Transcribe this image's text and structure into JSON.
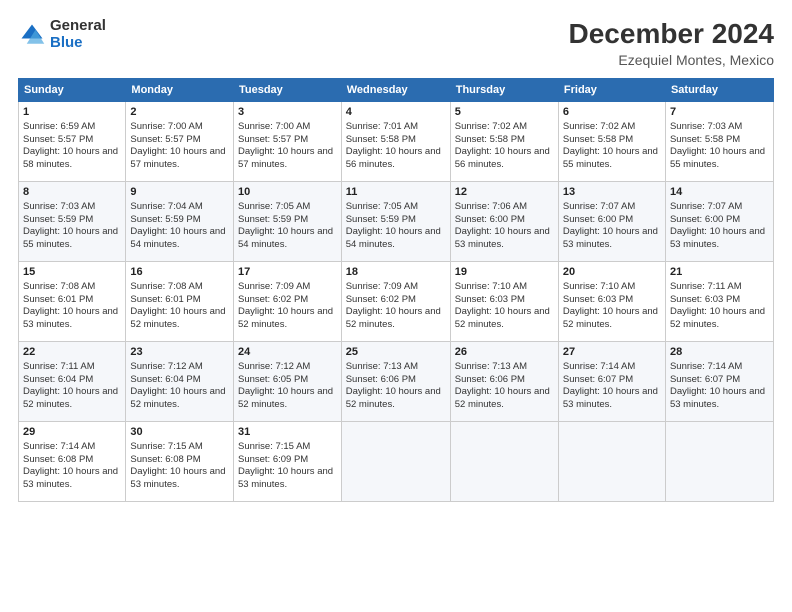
{
  "header": {
    "logo_general": "General",
    "logo_blue": "Blue",
    "month_title": "December 2024",
    "subtitle": "Ezequiel Montes, Mexico"
  },
  "days_of_week": [
    "Sunday",
    "Monday",
    "Tuesday",
    "Wednesday",
    "Thursday",
    "Friday",
    "Saturday"
  ],
  "weeks": [
    [
      {
        "day": "1",
        "sunrise": "6:59 AM",
        "sunset": "5:57 PM",
        "daylight": "10 hours and 58 minutes."
      },
      {
        "day": "2",
        "sunrise": "7:00 AM",
        "sunset": "5:57 PM",
        "daylight": "10 hours and 57 minutes."
      },
      {
        "day": "3",
        "sunrise": "7:00 AM",
        "sunset": "5:57 PM",
        "daylight": "10 hours and 57 minutes."
      },
      {
        "day": "4",
        "sunrise": "7:01 AM",
        "sunset": "5:58 PM",
        "daylight": "10 hours and 56 minutes."
      },
      {
        "day": "5",
        "sunrise": "7:02 AM",
        "sunset": "5:58 PM",
        "daylight": "10 hours and 56 minutes."
      },
      {
        "day": "6",
        "sunrise": "7:02 AM",
        "sunset": "5:58 PM",
        "daylight": "10 hours and 55 minutes."
      },
      {
        "day": "7",
        "sunrise": "7:03 AM",
        "sunset": "5:58 PM",
        "daylight": "10 hours and 55 minutes."
      }
    ],
    [
      {
        "day": "8",
        "sunrise": "7:03 AM",
        "sunset": "5:59 PM",
        "daylight": "10 hours and 55 minutes."
      },
      {
        "day": "9",
        "sunrise": "7:04 AM",
        "sunset": "5:59 PM",
        "daylight": "10 hours and 54 minutes."
      },
      {
        "day": "10",
        "sunrise": "7:05 AM",
        "sunset": "5:59 PM",
        "daylight": "10 hours and 54 minutes."
      },
      {
        "day": "11",
        "sunrise": "7:05 AM",
        "sunset": "5:59 PM",
        "daylight": "10 hours and 54 minutes."
      },
      {
        "day": "12",
        "sunrise": "7:06 AM",
        "sunset": "6:00 PM",
        "daylight": "10 hours and 53 minutes."
      },
      {
        "day": "13",
        "sunrise": "7:07 AM",
        "sunset": "6:00 PM",
        "daylight": "10 hours and 53 minutes."
      },
      {
        "day": "14",
        "sunrise": "7:07 AM",
        "sunset": "6:00 PM",
        "daylight": "10 hours and 53 minutes."
      }
    ],
    [
      {
        "day": "15",
        "sunrise": "7:08 AM",
        "sunset": "6:01 PM",
        "daylight": "10 hours and 53 minutes."
      },
      {
        "day": "16",
        "sunrise": "7:08 AM",
        "sunset": "6:01 PM",
        "daylight": "10 hours and 52 minutes."
      },
      {
        "day": "17",
        "sunrise": "7:09 AM",
        "sunset": "6:02 PM",
        "daylight": "10 hours and 52 minutes."
      },
      {
        "day": "18",
        "sunrise": "7:09 AM",
        "sunset": "6:02 PM",
        "daylight": "10 hours and 52 minutes."
      },
      {
        "day": "19",
        "sunrise": "7:10 AM",
        "sunset": "6:03 PM",
        "daylight": "10 hours and 52 minutes."
      },
      {
        "day": "20",
        "sunrise": "7:10 AM",
        "sunset": "6:03 PM",
        "daylight": "10 hours and 52 minutes."
      },
      {
        "day": "21",
        "sunrise": "7:11 AM",
        "sunset": "6:03 PM",
        "daylight": "10 hours and 52 minutes."
      }
    ],
    [
      {
        "day": "22",
        "sunrise": "7:11 AM",
        "sunset": "6:04 PM",
        "daylight": "10 hours and 52 minutes."
      },
      {
        "day": "23",
        "sunrise": "7:12 AM",
        "sunset": "6:04 PM",
        "daylight": "10 hours and 52 minutes."
      },
      {
        "day": "24",
        "sunrise": "7:12 AM",
        "sunset": "6:05 PM",
        "daylight": "10 hours and 52 minutes."
      },
      {
        "day": "25",
        "sunrise": "7:13 AM",
        "sunset": "6:06 PM",
        "daylight": "10 hours and 52 minutes."
      },
      {
        "day": "26",
        "sunrise": "7:13 AM",
        "sunset": "6:06 PM",
        "daylight": "10 hours and 52 minutes."
      },
      {
        "day": "27",
        "sunrise": "7:14 AM",
        "sunset": "6:07 PM",
        "daylight": "10 hours and 53 minutes."
      },
      {
        "day": "28",
        "sunrise": "7:14 AM",
        "sunset": "6:07 PM",
        "daylight": "10 hours and 53 minutes."
      }
    ],
    [
      {
        "day": "29",
        "sunrise": "7:14 AM",
        "sunset": "6:08 PM",
        "daylight": "10 hours and 53 minutes."
      },
      {
        "day": "30",
        "sunrise": "7:15 AM",
        "sunset": "6:08 PM",
        "daylight": "10 hours and 53 minutes."
      },
      {
        "day": "31",
        "sunrise": "7:15 AM",
        "sunset": "6:09 PM",
        "daylight": "10 hours and 53 minutes."
      },
      null,
      null,
      null,
      null
    ]
  ]
}
